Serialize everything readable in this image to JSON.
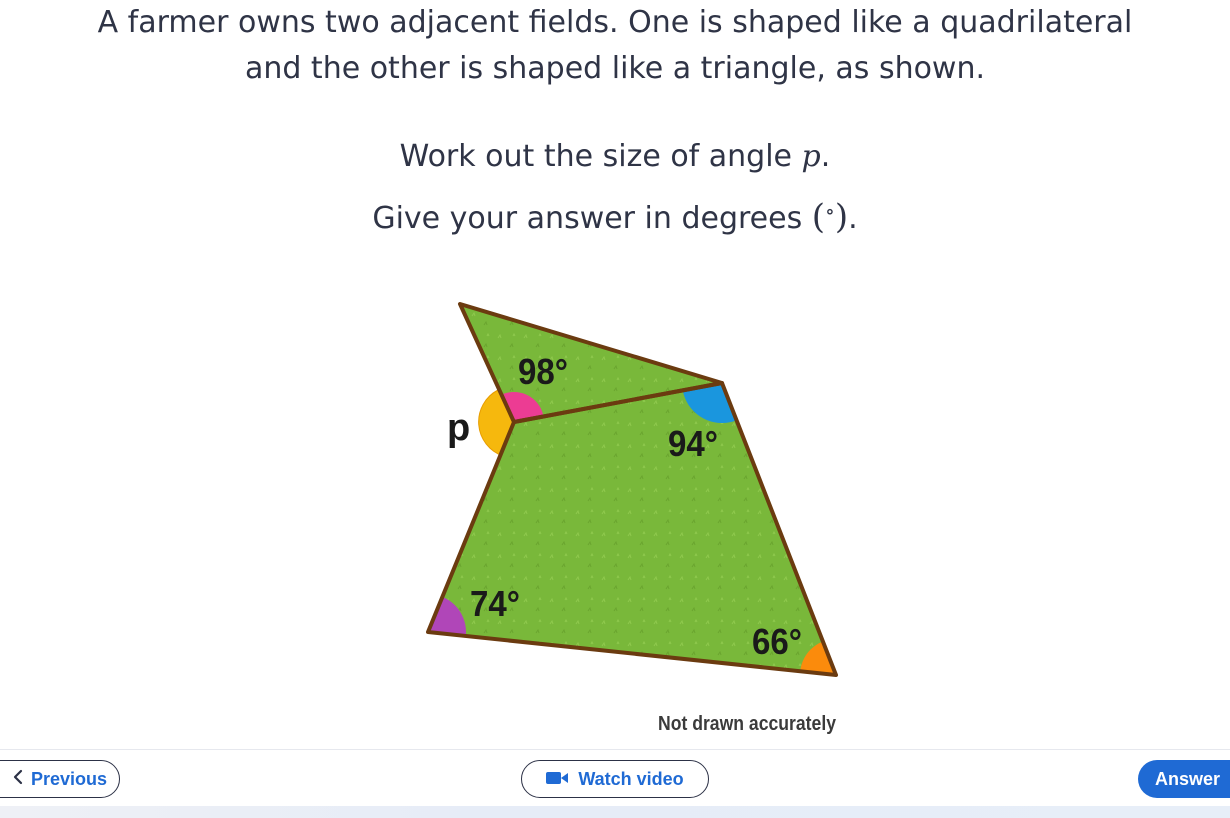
{
  "question": {
    "line1": "A farmer owns two adjacent fields. One is shaped like a quadrilateral",
    "line2": "and the other is shaped like a triangle, as shown.",
    "line3_prefix": "Work out the size of angle ",
    "line3_var": "p",
    "line3_suffix": ".",
    "line4_prefix": "Give your answer in degrees ",
    "line4_open": "(",
    "line4_deg": "∘",
    "line4_close": ")",
    "line4_suffix": "."
  },
  "diagram": {
    "angles": {
      "triangle_top": "98°",
      "quad_top_right": "94°",
      "quad_bottom_left": "74°",
      "quad_bottom_right": "66°",
      "unknown": "p"
    },
    "note": "Not drawn accurately",
    "colors": {
      "field_fill": "#79b83a",
      "field_stroke": "#6b3b10",
      "angle_yellow": "#f6b80d",
      "angle_pink": "#ec3c93",
      "angle_blue": "#1a96de",
      "angle_purple": "#b046b8",
      "angle_orange": "#fb8b0c"
    }
  },
  "nav": {
    "previous": "Previous",
    "watch_video": "Watch video",
    "answer": "Answer"
  },
  "icons": {
    "previous": "chevron-left-icon",
    "video": "video-camera-icon"
  },
  "accent_color": "#1f6ad4"
}
